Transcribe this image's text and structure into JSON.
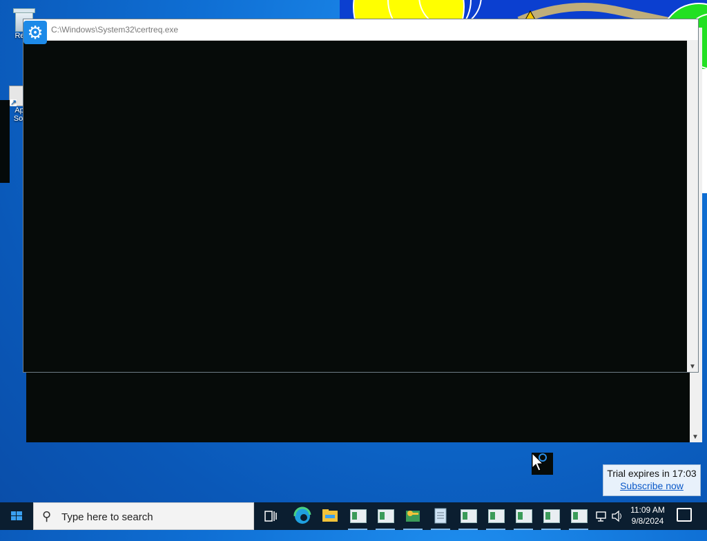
{
  "desktop": {
    "recycle_label": "Recy",
    "app_label_1": "Ap",
    "app_label_2": "Sof"
  },
  "window": {
    "title": "C:\\Windows\\System32\\certreq.exe",
    "icon": "gear-icon",
    "console_bg": "#060b09"
  },
  "notification": {
    "trial_text": "Trial expires in 17:03",
    "subscribe_text": "Subscribe now"
  },
  "taskbar": {
    "search_placeholder": "Type here to search",
    "time": "11:09 AM",
    "date": "9/8/2024",
    "apps": [
      "task-view-icon",
      "edge-icon",
      "file-explorer-icon",
      "key-manager-icon",
      "notepad-icon",
      "app-window-icon",
      "app-window-icon",
      "app-window-icon",
      "app-window-icon",
      "app-window-icon"
    ]
  }
}
